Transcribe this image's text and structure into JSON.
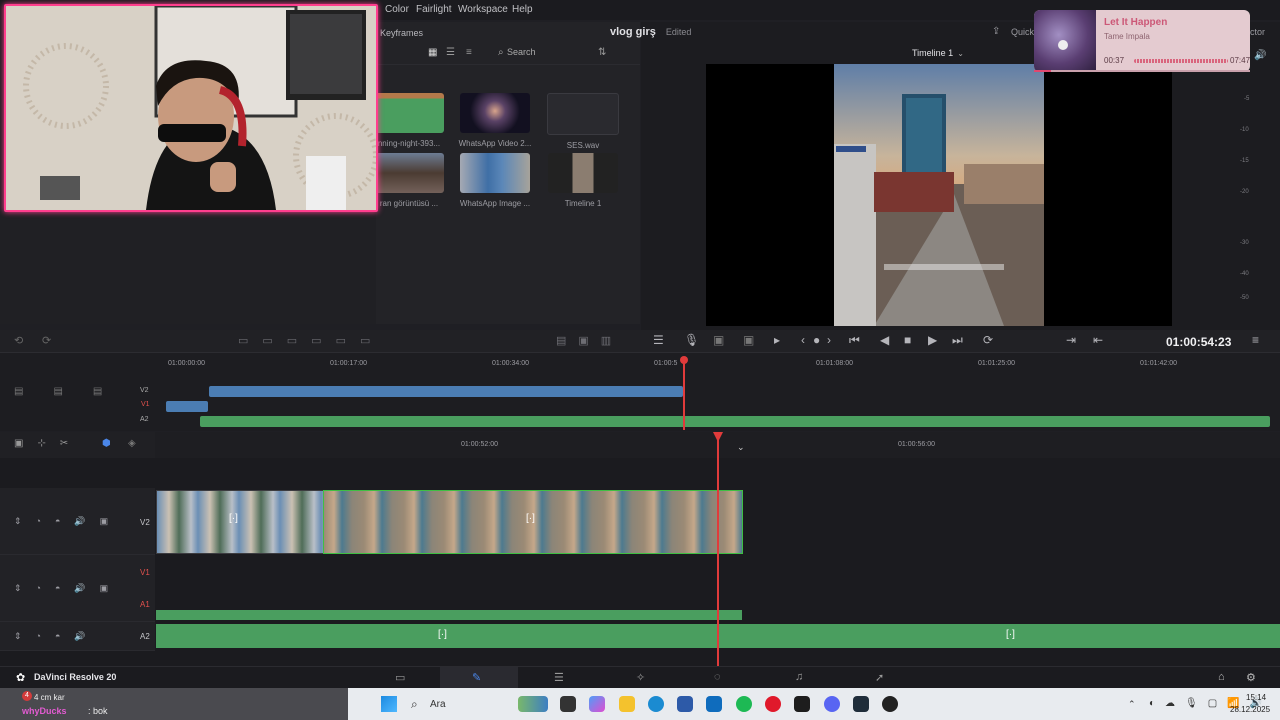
{
  "menu": {
    "color": "Color",
    "fairlight": "Fairlight",
    "workspace": "Workspace",
    "help": "Help"
  },
  "media_pool": {
    "keyframes_tab": "Keyframes",
    "search_placeholder": "Search",
    "clips": [
      {
        "label": "nning-night-393..."
      },
      {
        "label": "WhatsApp Video 2..."
      },
      {
        "label": "SES.wav"
      },
      {
        "label": "ran görüntüsü ..."
      },
      {
        "label": "WhatsApp Image ..."
      },
      {
        "label": "Timeline 1"
      }
    ]
  },
  "project": {
    "name": "vlog girş",
    "status": "Edited",
    "quick_export": "Quick",
    "inspector": "ctor"
  },
  "viewer": {
    "timeline_name": "Timeline 1",
    "timecode": "01:00:54:23",
    "audio_meter_labels": [
      "-5",
      "-10",
      "-15",
      "-20",
      "-30",
      "-40",
      "-50"
    ]
  },
  "overview_ruler": [
    "01:00:00:00",
    "01:00:17:00",
    "01:00:34:00",
    "01:00:5",
    "01:01:08:00",
    "01:01:25:00",
    "01:01:42:00"
  ],
  "overview_tracks": [
    "V2",
    "V1",
    "A2"
  ],
  "timeline_ruler": [
    "01:00:52:00",
    "01:00:56:00"
  ],
  "tracks": [
    {
      "label": "V2",
      "red": false
    },
    {
      "label": "V1",
      "red": true
    },
    {
      "label": "A1",
      "red": true
    },
    {
      "label": "A2",
      "red": false
    }
  ],
  "app": {
    "name": "DaVinci Resolve 20"
  },
  "taskbar": {
    "weather_temp": "4",
    "weather_text": "4 cm kar",
    "search_label": "Ara",
    "chat_user": "whyDucks",
    "chat_msg": ": bok",
    "time": "15:14",
    "date": "28.12.2025"
  },
  "now_playing": {
    "title": "Let It Happen",
    "artist": "Tame Impala",
    "elapsed": "00:37",
    "total": "07:47",
    "progress": 0.079
  },
  "colors": {
    "clip_blue": "#4b7db3",
    "audio_green": "#4a9e5f",
    "playhead": "#e03b3b",
    "webcam_border": "#ff3e8e"
  }
}
